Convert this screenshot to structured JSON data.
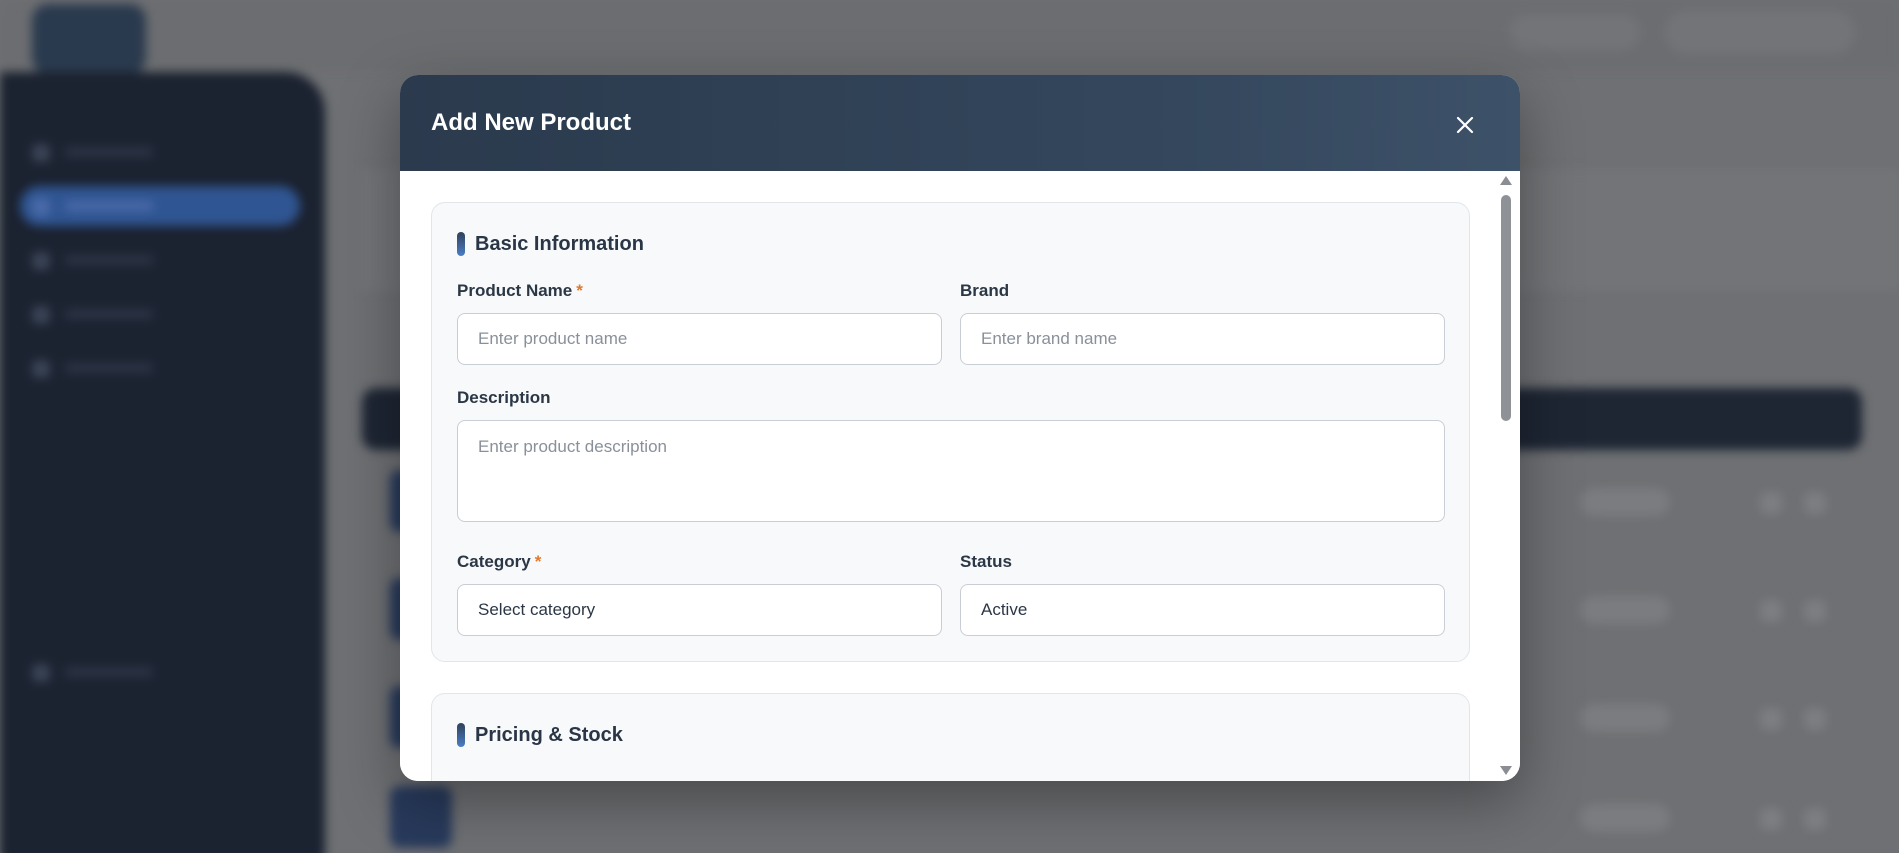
{
  "modal": {
    "title": "Add New Product",
    "close_icon": "close-icon"
  },
  "basic_info": {
    "title": "Basic Information",
    "product_name": {
      "label": "Product Name",
      "required_mark": "*",
      "placeholder": "Enter product name",
      "value": ""
    },
    "brand": {
      "label": "Brand",
      "placeholder": "Enter brand name",
      "value": ""
    },
    "description": {
      "label": "Description",
      "placeholder": "Enter product description",
      "value": ""
    },
    "category": {
      "label": "Category",
      "required_mark": "*",
      "selected": "Select category"
    },
    "status": {
      "label": "Status",
      "selected": "Active"
    }
  },
  "pricing_stock": {
    "title": "Pricing & Stock"
  },
  "colors": {
    "header_bg": "#2b3a4d",
    "required_accent": "#e0782f",
    "section_accent": "#4a7fc6",
    "overlay": "#6e7073"
  }
}
